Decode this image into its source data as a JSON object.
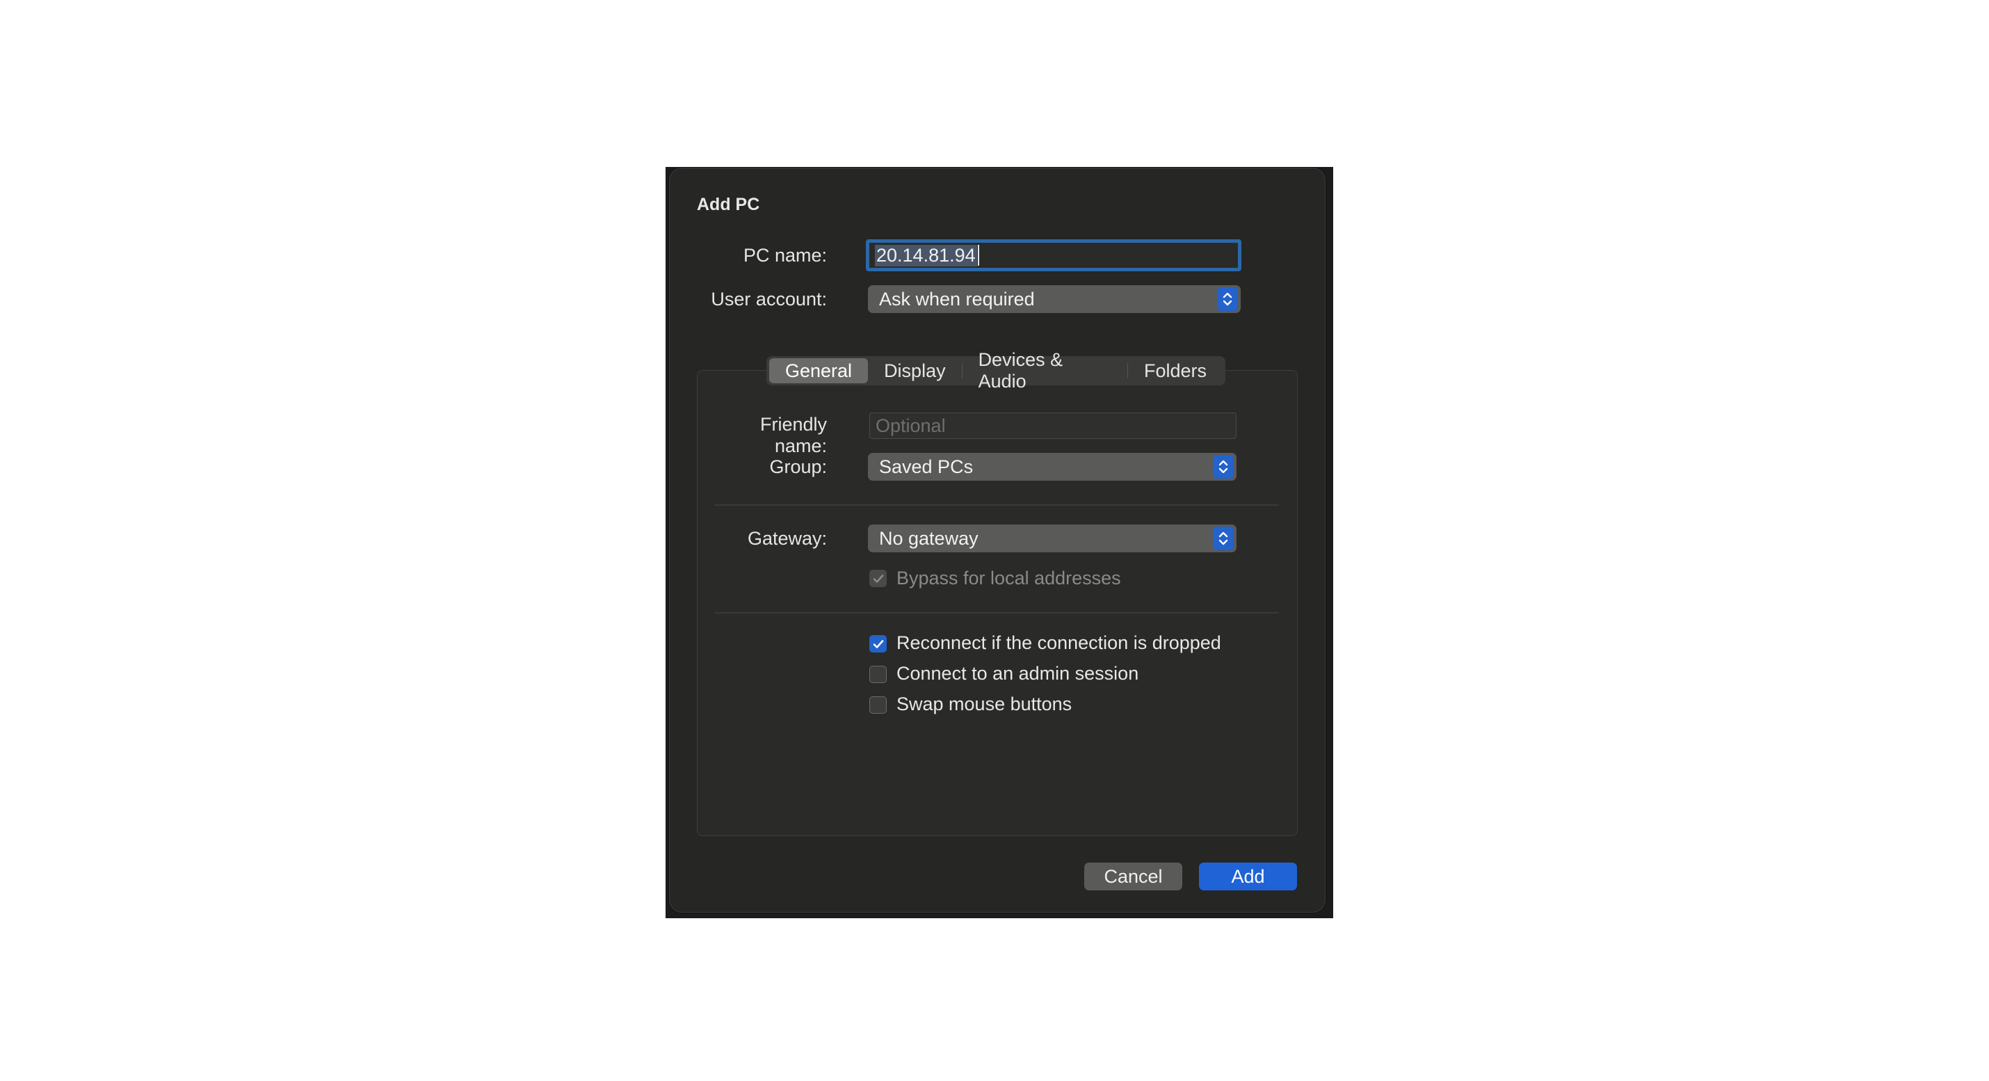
{
  "dialog": {
    "title": "Add PC",
    "pc_name_label": "PC name:",
    "pc_name_value": "20.14.81.94",
    "user_account_label": "User account:",
    "user_account_value": "Ask when required"
  },
  "tabs": [
    {
      "label": "General",
      "active": true
    },
    {
      "label": "Display",
      "active": false
    },
    {
      "label": "Devices & Audio",
      "active": false
    },
    {
      "label": "Folders",
      "active": false
    }
  ],
  "general": {
    "friendly_name_label": "Friendly name:",
    "friendly_name_placeholder": "Optional",
    "group_label": "Group:",
    "group_value": "Saved PCs",
    "gateway_label": "Gateway:",
    "gateway_value": "No gateway",
    "bypass_label": "Bypass for local addresses",
    "bypass_checked": true,
    "bypass_enabled": false,
    "options": [
      {
        "label": "Reconnect if the connection is dropped",
        "checked": true
      },
      {
        "label": "Connect to an admin session",
        "checked": false
      },
      {
        "label": "Swap mouse buttons",
        "checked": false
      }
    ]
  },
  "buttons": {
    "cancel": "Cancel",
    "add": "Add"
  },
  "colors": {
    "accent": "#1f63d6",
    "dialog_bg": "#262624",
    "focus_ring": "#2b68a8"
  }
}
